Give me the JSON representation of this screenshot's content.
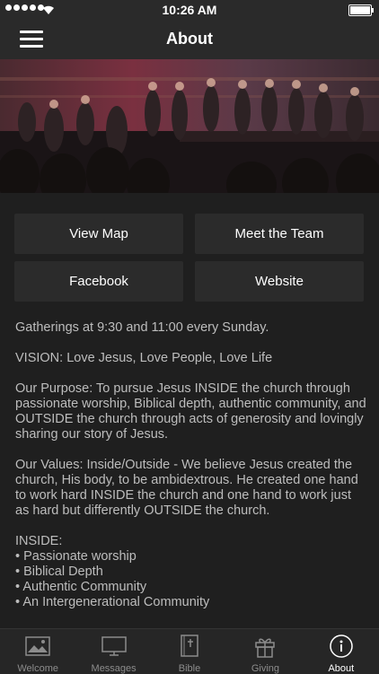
{
  "status_bar": {
    "time": "10:26 AM"
  },
  "header": {
    "title": "About"
  },
  "buttons": {
    "view_map": "View Map",
    "meet_team": "Meet the Team",
    "facebook": "Facebook",
    "website": "Website"
  },
  "content": {
    "gatherings": "Gatherings at 9:30 and 11:00 every Sunday.",
    "vision": "VISION: Love Jesus, Love People, Love Life",
    "purpose": "Our Purpose:  To pursue Jesus INSIDE the church through passionate worship, Biblical depth, authentic community, and OUTSIDE the church through acts of generosity and lovingly sharing our story of Jesus.",
    "values": "Our Values: Inside/Outside - We believe Jesus created the church, His body, to be ambidextrous.  He created one hand to work hard INSIDE the church and one hand to work just as hard but differently OUTSIDE the church.",
    "inside_heading": "INSIDE:",
    "inside_items": [
      "Passionate worship",
      "Biblical Depth",
      "Authentic Community",
      "An Intergenerational Community"
    ]
  },
  "tabs": [
    {
      "label": "Welcome",
      "icon": "image-icon"
    },
    {
      "label": "Messages",
      "icon": "monitor-icon"
    },
    {
      "label": "Bible",
      "icon": "bible-icon"
    },
    {
      "label": "Giving",
      "icon": "gift-icon"
    },
    {
      "label": "About",
      "icon": "info-icon",
      "active": true
    }
  ]
}
